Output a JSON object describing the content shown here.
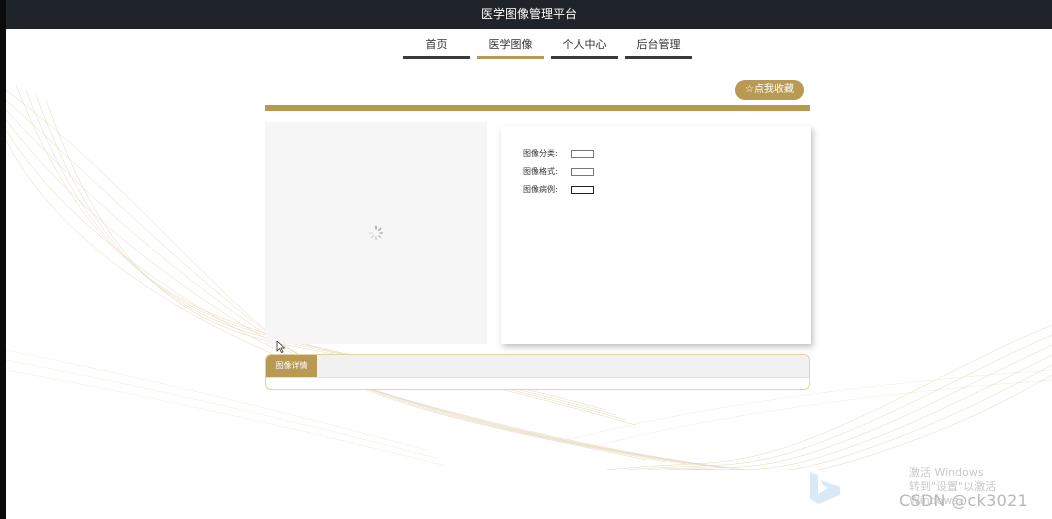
{
  "window": {
    "title": "医学图像管理平台"
  },
  "nav": {
    "items": [
      "首页",
      "医学图像",
      "个人中心",
      "后台管理"
    ],
    "active_index": 1
  },
  "favorite_button": {
    "icon": "☆",
    "label": "点我收藏"
  },
  "image_panel": {
    "state": "loading"
  },
  "info": {
    "category_label": "图像分类:",
    "format_label": "图像格式:",
    "case_label": "图像病例:"
  },
  "detail": {
    "tab_label": "图像详情"
  },
  "overlay": {
    "activation_line1": "激活 Windows",
    "activation_line2": "转到\"设置\"以激活 Windows。",
    "csdn_watermark": "CSDN @ck3021"
  },
  "colors": {
    "accent": "#b79a4f",
    "titlebar": "#1f242b",
    "panel": "#f6f6f6"
  }
}
